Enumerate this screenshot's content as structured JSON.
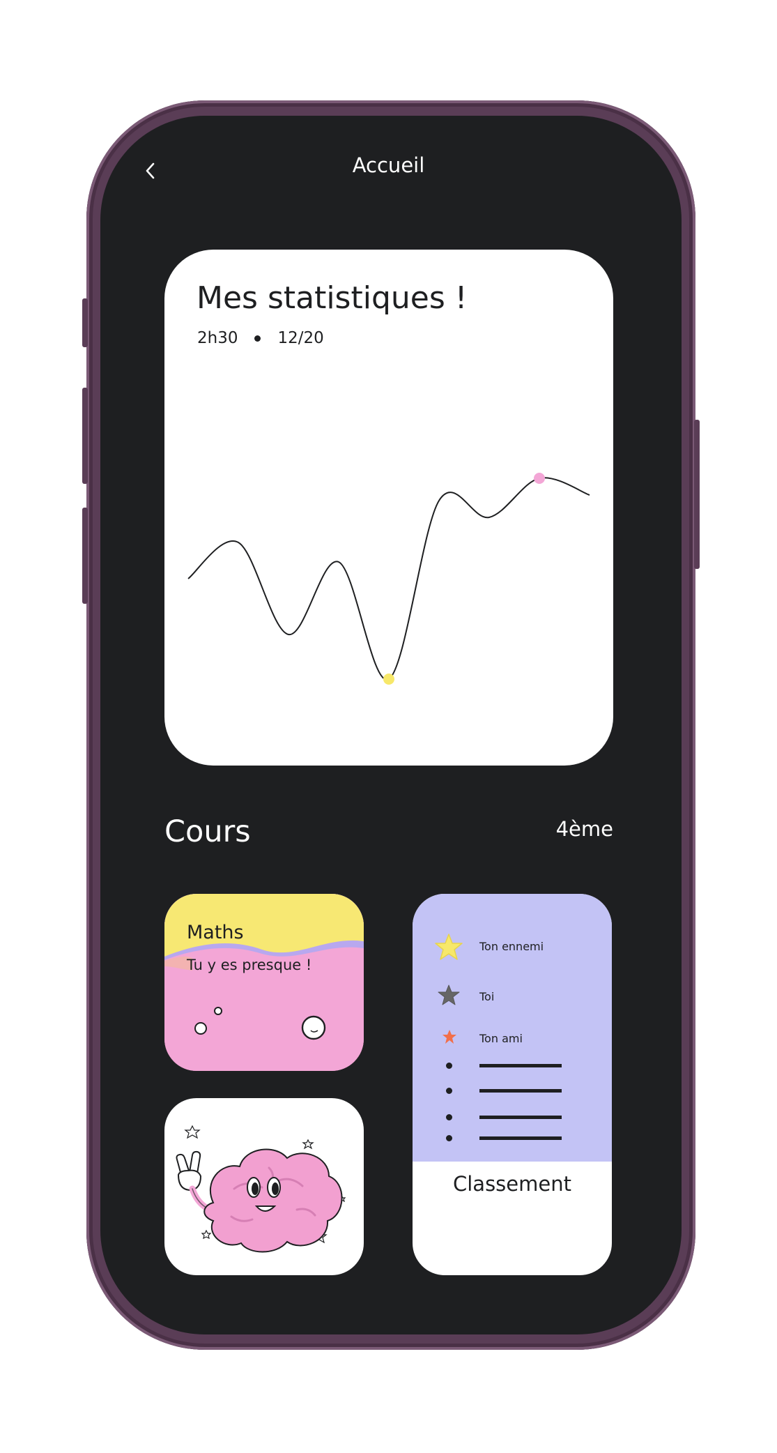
{
  "header": {
    "title": "Accueil",
    "back_icon": "chevron-left-icon"
  },
  "stats": {
    "title": "Mes statistiques !",
    "duration": "2h30",
    "grade": "12/20"
  },
  "chart_data": {
    "type": "line",
    "title": "",
    "xlabel": "",
    "ylabel": "",
    "grid": false,
    "series": [
      {
        "values": [
          0.42,
          0.55,
          0.22,
          0.48,
          0.06,
          0.7,
          0.64,
          0.78,
          0.72
        ]
      }
    ],
    "highlights": [
      {
        "label": "min",
        "color": "#f7e86a"
      },
      {
        "label": "max",
        "color": "#f3a6d6"
      }
    ]
  },
  "courses": {
    "section_title": "Cours",
    "level": "4ème",
    "maths": {
      "title": "Maths",
      "subtitle": "Tu y es presque !",
      "bg_top": "#f7e873",
      "bg_bottom": "#f3a6d6"
    },
    "brain_illustration": "brain-mascot-icon"
  },
  "ranking": {
    "entries": [
      {
        "label": "Ton ennemi",
        "icon": "gold-star-icon",
        "color": "#f7e86a"
      },
      {
        "label": "Toi",
        "icon": "grey-star-icon",
        "color": "#666666"
      },
      {
        "label": "Ton ami",
        "icon": "orange-star-icon",
        "color": "#f26f4a"
      }
    ],
    "title": "Classement",
    "bg": "#c3c3f5"
  },
  "colors": {
    "screen_bg": "#1e1f21",
    "frame": "#5a3d56"
  }
}
